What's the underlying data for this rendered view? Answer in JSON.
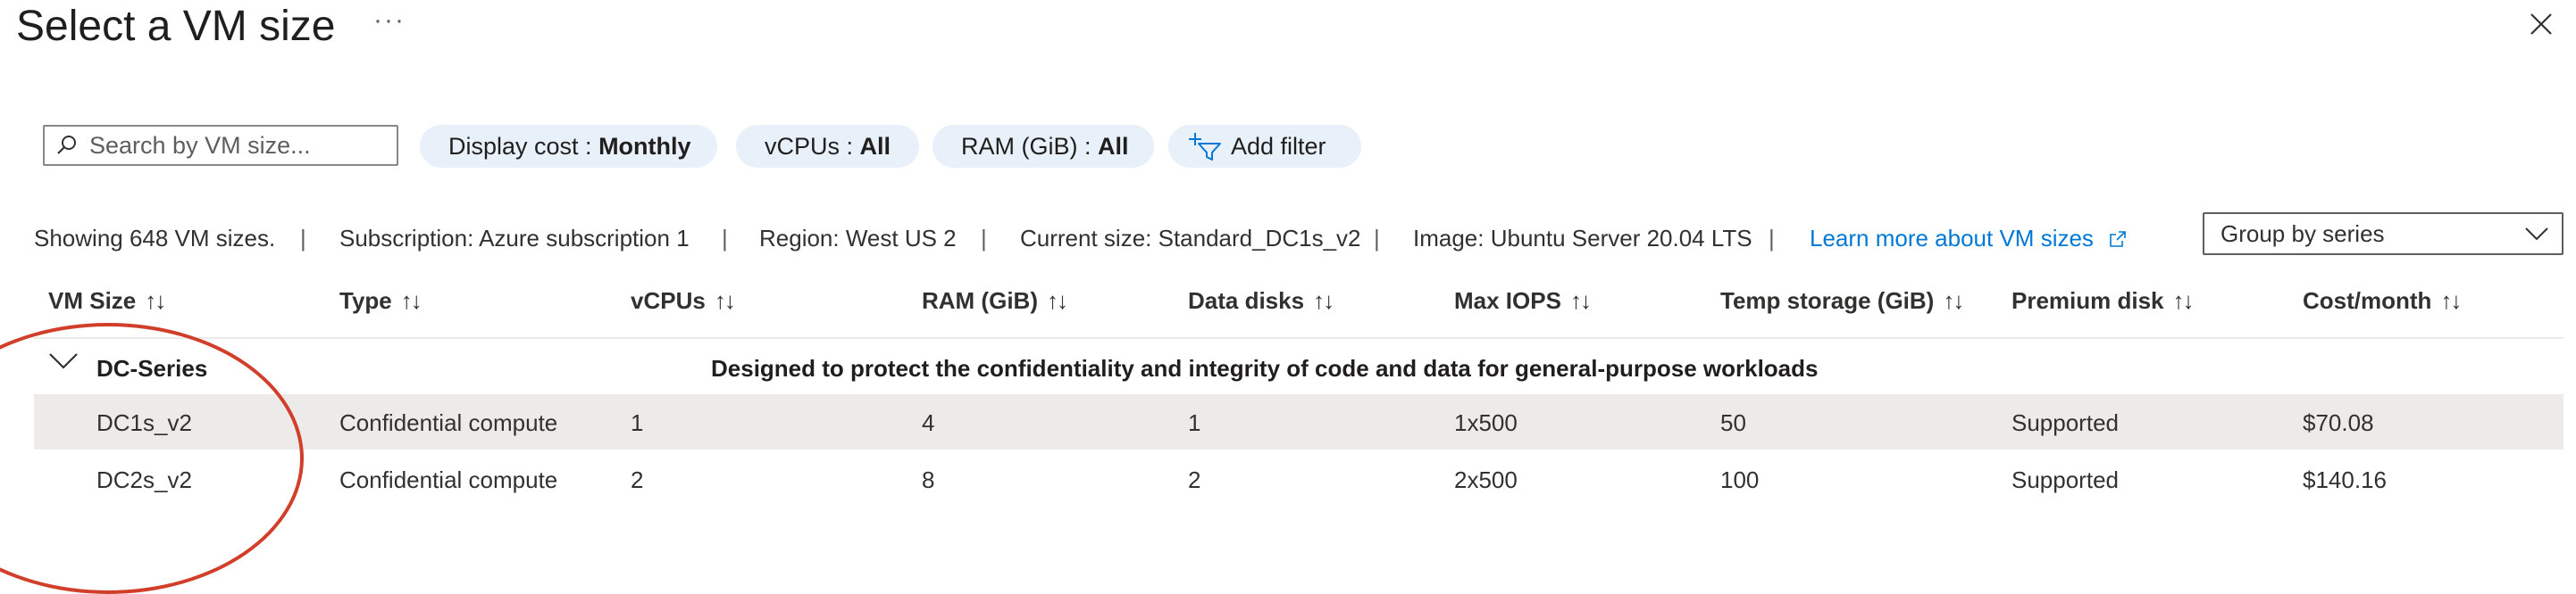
{
  "header": {
    "title": "Select a VM size",
    "more_label": "···"
  },
  "toolbar": {
    "search_placeholder": "Search by VM size...",
    "display_cost_label": "Display cost : ",
    "display_cost_value": "Monthly",
    "vcpus_label": "vCPUs : ",
    "vcpus_value": "All",
    "ram_label": "RAM (GiB) : ",
    "ram_value": "All",
    "add_filter_label": "Add filter"
  },
  "info": {
    "showing": "Showing 648 VM sizes.",
    "subscription": "Subscription: Azure subscription 1",
    "region": "Region: West US 2",
    "current_size": "Current size: Standard_DC1s_v2",
    "image": "Image: Ubuntu Server 20.04 LTS",
    "learn_more": "Learn more about VM sizes",
    "separator": "|",
    "group_by": "Group by series"
  },
  "table": {
    "columns": [
      "VM Size",
      "Type",
      "vCPUs",
      "RAM (GiB)",
      "Data disks",
      "Max IOPS",
      "Temp storage (GiB)",
      "Premium disk",
      "Cost/month"
    ],
    "sort_glyph": "↑↓",
    "group": {
      "name": "DC-Series",
      "description": "Designed to protect the confidentiality and integrity of code and data for general-purpose workloads"
    },
    "rows": [
      [
        "DC1s_v2",
        "Confidential compute",
        "1",
        "4",
        "1",
        "1x500",
        "50",
        "Supported",
        "$70.08"
      ],
      [
        "DC2s_v2",
        "Confidential compute",
        "2",
        "8",
        "2",
        "2x500",
        "100",
        "Supported",
        "$140.16"
      ]
    ]
  },
  "colors": {
    "accent": "#0078d4",
    "selected_row": "#edebe9",
    "pill_bg": "#e8f0fa",
    "annotation_circle": "#d13f2b"
  }
}
